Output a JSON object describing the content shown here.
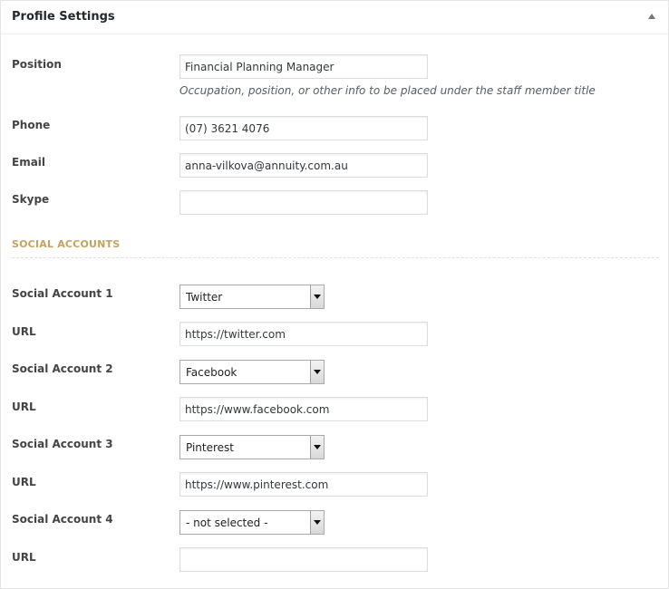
{
  "panel": {
    "title": "Profile Settings"
  },
  "fields": {
    "position": {
      "label": "Position",
      "value": "Financial Planning Manager",
      "description": "Occupation, position, or other info to be placed under the staff member title"
    },
    "phone": {
      "label": "Phone",
      "value": "(07) 3621 4076"
    },
    "email": {
      "label": "Email",
      "value": "anna-vilkova@annuity.com.au"
    },
    "skype": {
      "label": "Skype",
      "value": ""
    }
  },
  "social": {
    "heading": "SOCIAL ACCOUNTS",
    "url_label": "URL",
    "accounts": [
      {
        "label": "Social Account 1",
        "selected": "Twitter",
        "url": "https://twitter.com"
      },
      {
        "label": "Social Account 2",
        "selected": "Facebook",
        "url": "https://www.facebook.com"
      },
      {
        "label": "Social Account 3",
        "selected": "Pinterest",
        "url": "https://www.pinterest.com"
      },
      {
        "label": "Social Account 4",
        "selected": "- not selected -",
        "url": ""
      }
    ]
  },
  "colors": {
    "section_heading": "#c8a25a",
    "border": "#dddddd"
  }
}
